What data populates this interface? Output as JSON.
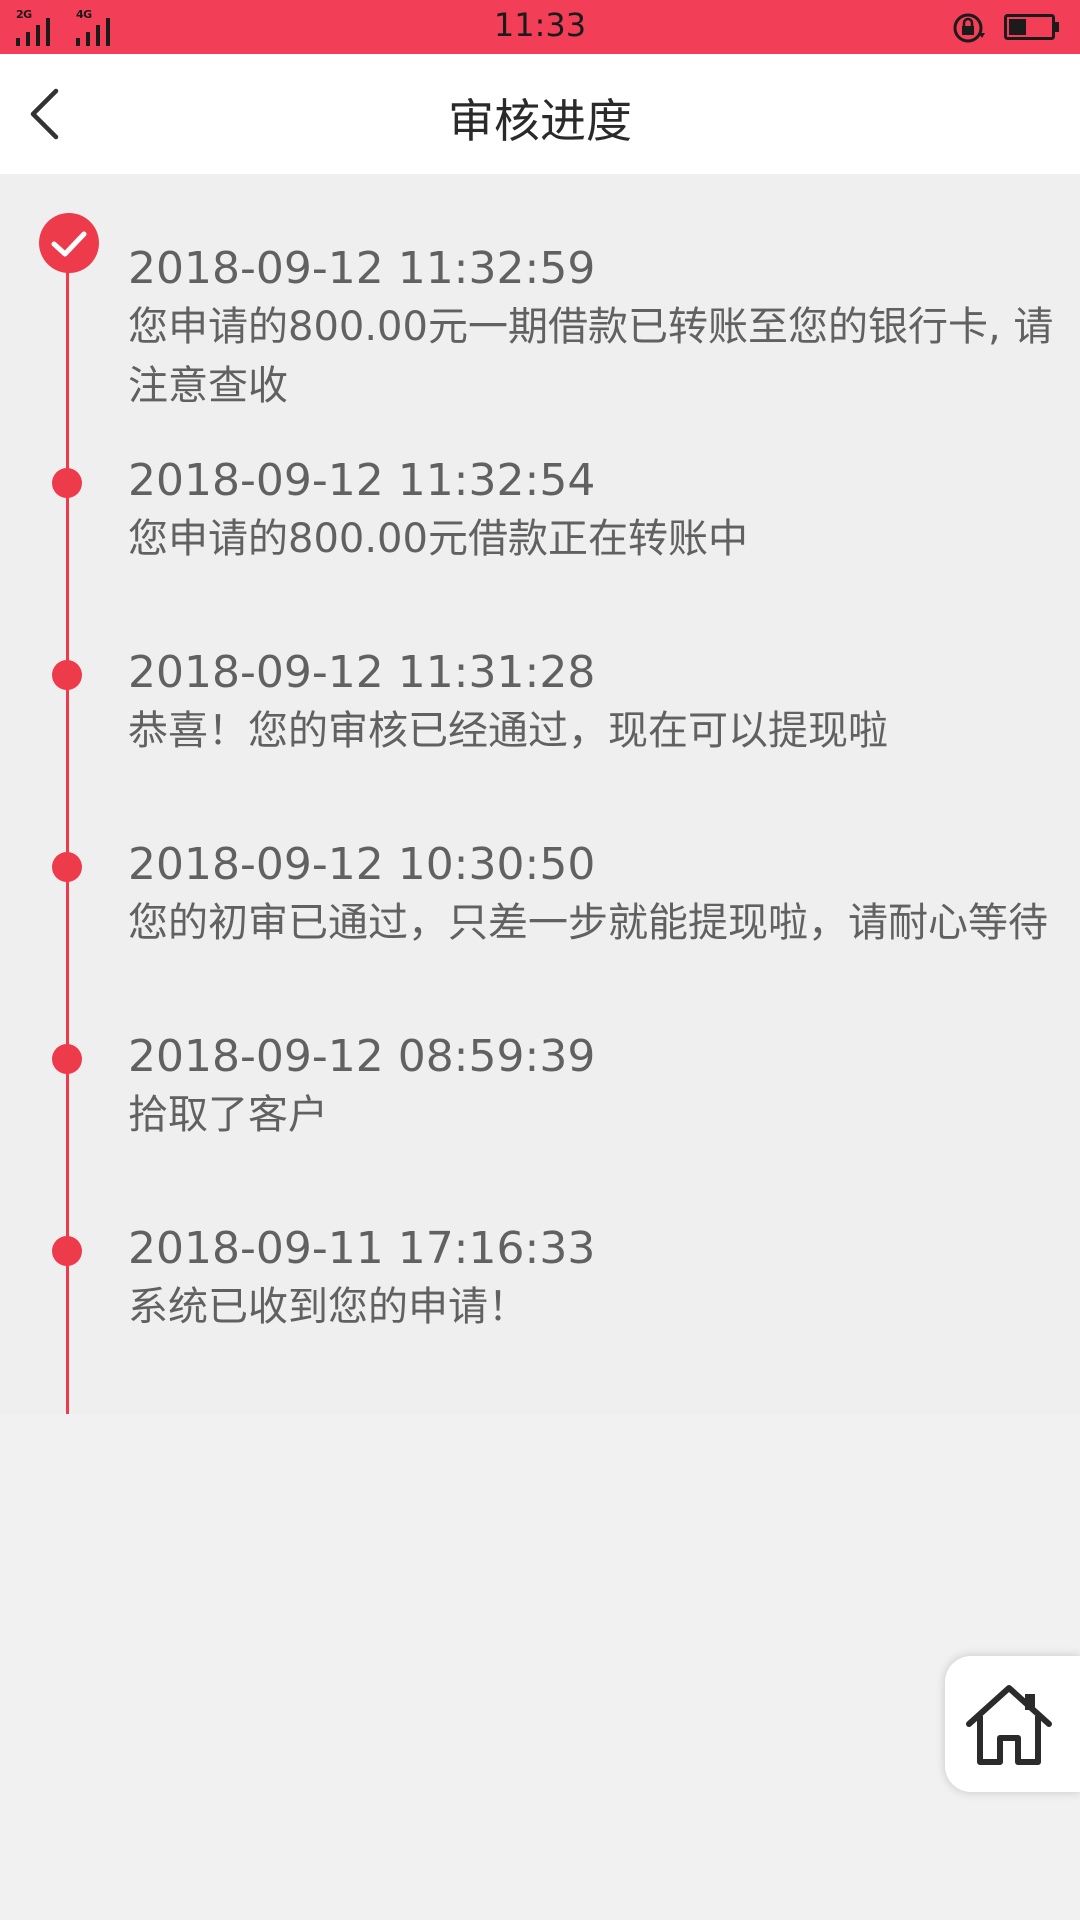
{
  "status_bar": {
    "network_1": "2G",
    "network_2": "4G",
    "time": "11:33",
    "battery_level": 0.4
  },
  "header": {
    "title": "审核进度"
  },
  "timeline": [
    {
      "time": "2018-09-12 11:32:59",
      "message": "您申请的800.00元一期借款已转账至您的银行卡, 请注意查收",
      "marker": "check-icon"
    },
    {
      "time": "2018-09-12 11:32:54",
      "message": "您申请的800.00元借款正在转账中",
      "marker": "dot-icon"
    },
    {
      "time": "2018-09-12 11:31:28",
      "message": "恭喜！您的审核已经通过，现在可以提现啦",
      "marker": "dot-icon"
    },
    {
      "time": "2018-09-12 10:30:50",
      "message": "您的初审已通过，只差一步就能提现啦，请耐心等待",
      "marker": "dot-icon"
    },
    {
      "time": "2018-09-12 08:59:39",
      "message": "拾取了客户",
      "marker": "dot-icon"
    },
    {
      "time": "2018-09-11 17:16:33",
      "message": "系统已收到您的申请！",
      "marker": "dot-icon"
    }
  ],
  "colors": {
    "status_bar": "#f23e57",
    "accent": "#ee3b4c",
    "background": "#f1f1f1",
    "text": "#616161"
  },
  "icons": {
    "back": "chevron-left-icon",
    "home": "home-icon"
  }
}
